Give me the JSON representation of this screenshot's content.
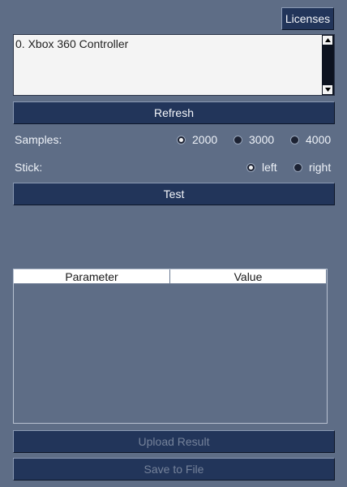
{
  "header": {
    "licenses_label": "Licenses"
  },
  "device_list": {
    "items": [
      "0. Xbox 360 Controller"
    ],
    "scroll_up_icon": "triangle-up-icon",
    "scroll_down_icon": "triangle-down-icon"
  },
  "actions": {
    "refresh_label": "Refresh",
    "test_label": "Test"
  },
  "samples": {
    "label": "Samples:",
    "options": [
      "2000",
      "3000",
      "4000"
    ],
    "selected": "2000"
  },
  "stick": {
    "label": "Stick:",
    "options": [
      "left",
      "right"
    ],
    "selected": "left"
  },
  "results_table": {
    "columns": [
      "Parameter",
      "Value"
    ],
    "rows": []
  },
  "footer": {
    "upload_label": "Upload Result",
    "save_label": "Save to File"
  },
  "colors": {
    "background": "#5e6d86",
    "button": "#22355a",
    "disabled_text": "#75829a"
  }
}
